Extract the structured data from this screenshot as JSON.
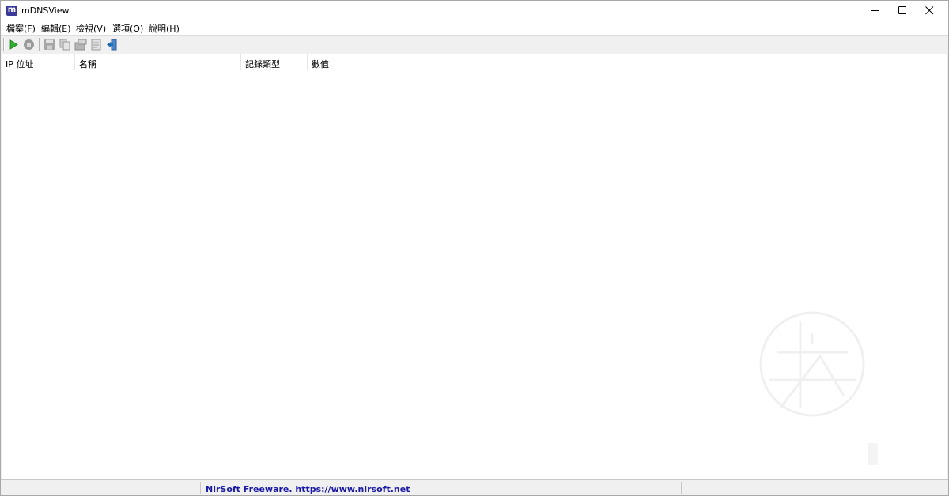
{
  "window": {
    "title": "mDNSView",
    "icon_letter": "m",
    "controls": [
      "minimize-icon",
      "maximize-icon",
      "close-icon"
    ]
  },
  "menu": {
    "items": [
      {
        "label": "檔案(F)"
      },
      {
        "label": "編輯(E)"
      },
      {
        "label": "檢視(V)"
      },
      {
        "label": "選項(O)"
      },
      {
        "label": "說明(H)"
      }
    ]
  },
  "toolbar": {
    "buttons": [
      "start-icon",
      "stop-icon",
      "save-icon",
      "copy-icon",
      "properties-icon",
      "html-report-icon",
      "exit-icon"
    ]
  },
  "table": {
    "columns": [
      "IP 位址",
      "名稱",
      "記錄類型",
      "數值"
    ],
    "rows": []
  },
  "status": {
    "link_text": "NirSoft Freeware. https://www.nirsoft.net",
    "link_color": "#1a1aa6"
  }
}
